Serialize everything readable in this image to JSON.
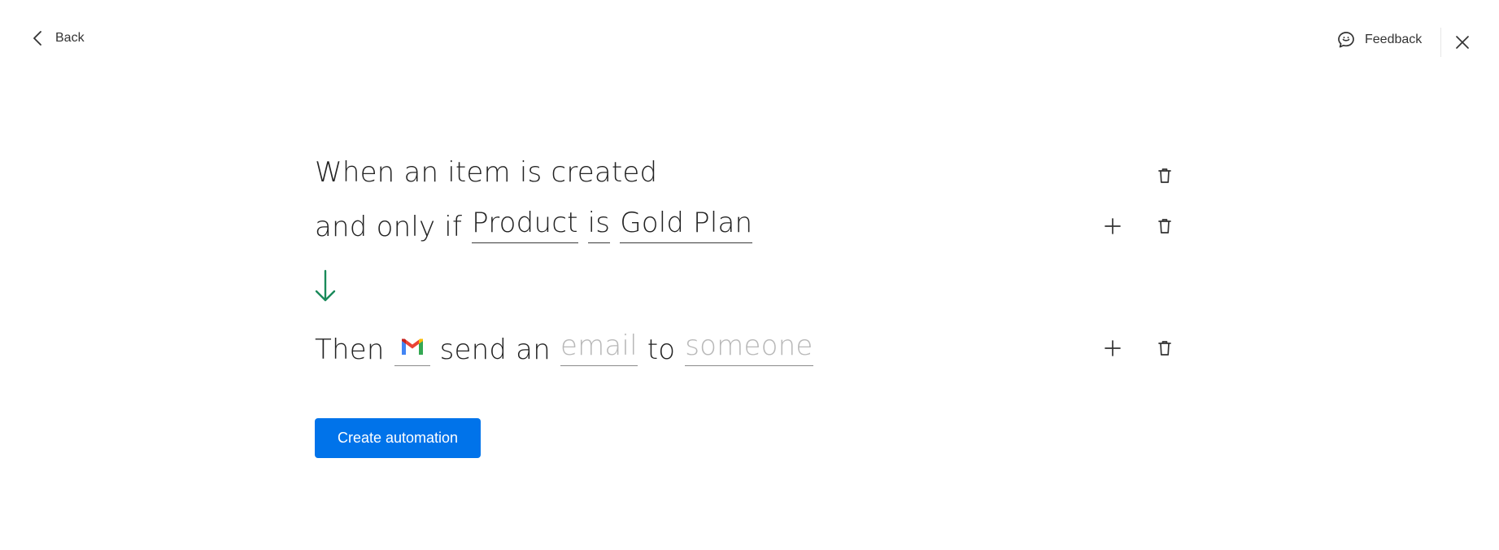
{
  "header": {
    "back_label": "Back",
    "feedback_label": "Feedback"
  },
  "trigger": {
    "text": "When an item is created"
  },
  "condition": {
    "prefix": "and only if",
    "field": "Product",
    "operator": "is",
    "value": "Gold Plan"
  },
  "action": {
    "prefix": "Then",
    "service_icon": "gmail-icon",
    "verb": "send an",
    "object": "email",
    "connector": "to",
    "recipient": "someone"
  },
  "footer": {
    "create_label": "Create automation"
  },
  "colors": {
    "accent": "#0073ea",
    "arrow": "#1a8a5a",
    "placeholder_text": "#b8b8b8"
  }
}
